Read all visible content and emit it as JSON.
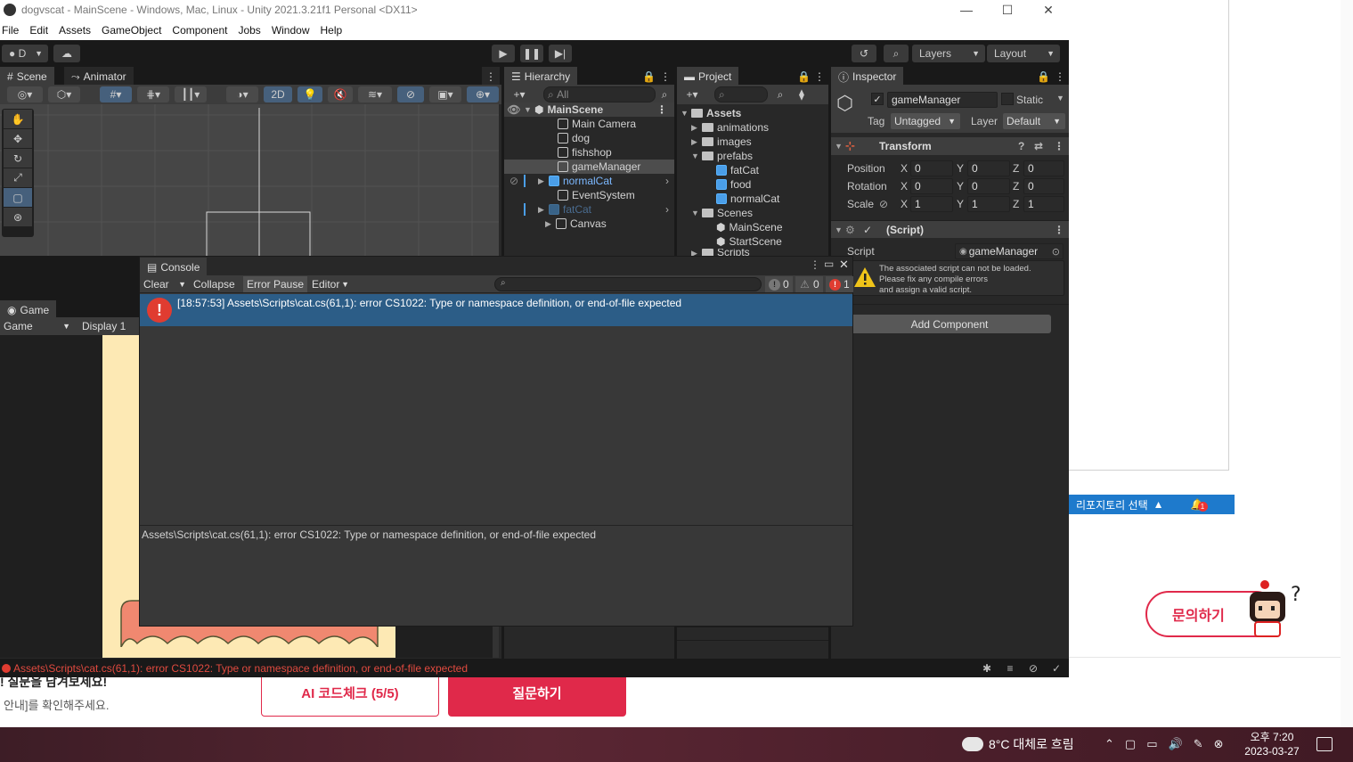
{
  "window": {
    "title": "dogvscat - MainScene - Windows, Mac, Linux - Unity 2021.3.21f1 Personal <DX11>",
    "controls": {
      "minimize": "—",
      "maximize": "☐",
      "close": "✕"
    }
  },
  "menu": [
    "File",
    "Edit",
    "Assets",
    "GameObject",
    "Component",
    "Jobs",
    "Window",
    "Help"
  ],
  "toolbar": {
    "account": "D",
    "layers": "Layers",
    "layout": "Layout"
  },
  "scene": {
    "tabs": [
      "Scene",
      "Animator"
    ],
    "mode_2d": "2D"
  },
  "game": {
    "tab": "Game",
    "mode": "Game",
    "display": "Display 1"
  },
  "hierarchy": {
    "tab": "Hierarchy",
    "search_placeholder": "All",
    "scene": "MainScene",
    "items": [
      "Main Camera",
      "dog",
      "fishshop",
      "gameManager",
      "normalCat",
      "EventSystem",
      "fatCat",
      "Canvas"
    ]
  },
  "project": {
    "tab": "Project",
    "root": "Assets",
    "folders": [
      "animations",
      "images",
      "prefabs"
    ],
    "prefabs": [
      "fatCat",
      "food",
      "normalCat"
    ],
    "scenes_folder": "Scenes",
    "scenes": [
      "MainScene",
      "StartScene"
    ],
    "scripts_folder": "Scripts"
  },
  "inspector": {
    "tab": "Inspector",
    "object_name": "gameManager",
    "static_label": "Static",
    "tag_label": "Tag",
    "tag_value": "Untagged",
    "layer_label": "Layer",
    "layer_value": "Default",
    "transform": {
      "title": "Transform",
      "position_label": "Position",
      "rotation_label": "Rotation",
      "scale_label": "Scale",
      "position": {
        "x": "0",
        "y": "0",
        "z": "0"
      },
      "rotation": {
        "x": "0",
        "y": "0",
        "z": "0"
      },
      "scale": {
        "x": "1",
        "y": "1",
        "z": "1"
      },
      "axis_x": "X",
      "axis_y": "Y",
      "axis_z": "Z"
    },
    "script_component": {
      "title": "(Script)",
      "script_label": "Script",
      "script_value": "gameManager",
      "warning_line1": "The associated script can not be loaded.",
      "warning_line2": "Please fix any compile errors",
      "warning_line3": "and assign a valid script."
    },
    "add_component": "Add Component"
  },
  "console": {
    "title": "Console",
    "clear": "Clear",
    "collapse": "Collapse",
    "error_pause": "Error Pause",
    "editor": "Editor",
    "count_info": "0",
    "count_warn": "0",
    "count_error": "1",
    "log_entry": "[18:57:53] Assets\\Scripts\\cat.cs(61,1): error CS1022: Type or namespace definition, or end-of-file expected",
    "detail": "Assets\\Scripts\\cat.cs(61,1): error CS1022: Type or namespace definition, or end-of-file expected"
  },
  "statusbar": {
    "message": "Assets\\Scripts\\cat.cs(61,1): error CS1022: Type or namespace definition, or end-of-file expected"
  },
  "web": {
    "repo_select": "리포지토리 선택",
    "bell_count": "1",
    "ask_button": "문의하기",
    "bottom_text1": "! 질문을 남겨보세요!",
    "bottom_text2": "안내]를 확인해주세요.",
    "ai_button": "AI 코드체크 (5/5)",
    "question_button": "질문하기"
  },
  "taskbar": {
    "weather": "8°C  대체로 흐림",
    "time": "오후 7:20",
    "date": "2023-03-27"
  },
  "colors": {
    "unity_bg": "#282828",
    "selection": "#2c5d87",
    "error_red": "#e03c31",
    "brand_red": "#e0294a"
  }
}
